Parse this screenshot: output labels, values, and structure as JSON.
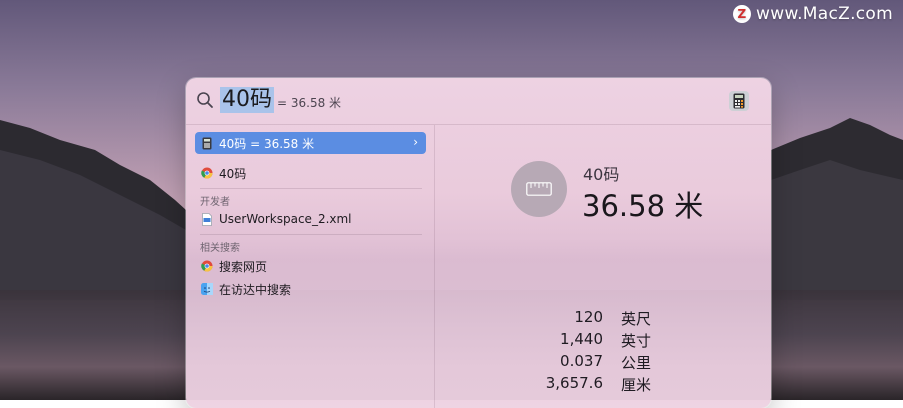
{
  "watermark": {
    "logo_letter": "Z",
    "text": "www.MacZ.com"
  },
  "search": {
    "query": "40码",
    "inline_result": "= 36.58 米"
  },
  "results": [
    {
      "label": "40码 = 36.58 米",
      "icon": "calculator-icon",
      "selected": true
    },
    {
      "label": "40码",
      "icon": "chrome-icon",
      "selected": false
    }
  ],
  "sections": {
    "developer": {
      "title": "开发者",
      "items": [
        {
          "label": "UserWorkspace_2.xml",
          "icon": "xml-file-icon"
        }
      ]
    },
    "related": {
      "title": "相关搜索",
      "items": [
        {
          "label": "搜索网页",
          "icon": "chrome-icon"
        },
        {
          "label": "在访达中搜索",
          "icon": "finder-icon"
        }
      ]
    }
  },
  "preview": {
    "source": "40码",
    "result": "36.58 米",
    "conversions": [
      {
        "value": "120",
        "unit": "英尺"
      },
      {
        "value": "1,440",
        "unit": "英寸"
      },
      {
        "value": "0.037",
        "unit": "公里"
      },
      {
        "value": "3,657.6",
        "unit": "厘米"
      }
    ]
  },
  "colors": {
    "selection": "#5b8de2",
    "query_highlight": "#a9c3ea",
    "watermark_logo": "#d0302f"
  }
}
